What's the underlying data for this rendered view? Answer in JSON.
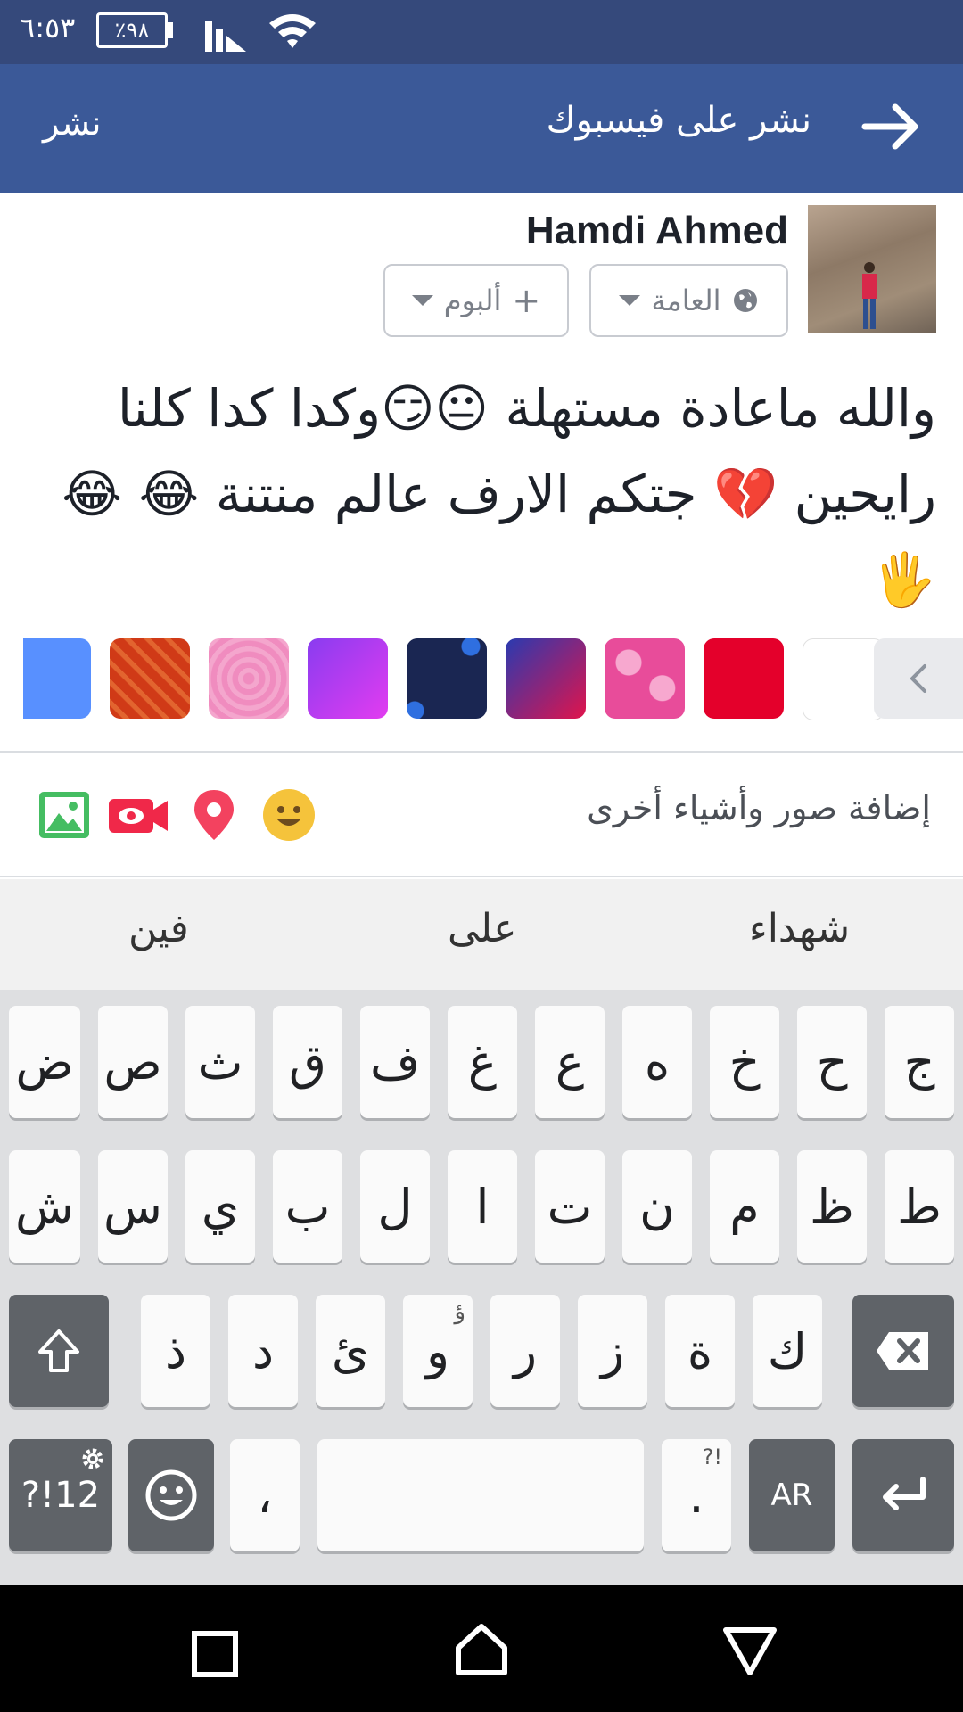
{
  "status_bar": {
    "time": "٦:٥٣",
    "battery": "٪٩٨"
  },
  "app_bar": {
    "post_label": "نشر",
    "title": "نشر على فيسبوك"
  },
  "composer": {
    "user_name": "Hamdi Ahmed",
    "privacy_label": "العامة",
    "album_label": "ألبوم",
    "post_text": "والله ماعادة مستهلة 😐😏وكدا كدا كلنا رايحين 💔 جتكم الارف عالم منتنة 😂 😂🖐"
  },
  "backgrounds": {
    "colors": [
      "#ffffff",
      "#e4002b",
      "#e84c9a",
      "#a6167a",
      "#1a2652",
      "#c13bf0",
      "#f08cbf",
      "#d03a17",
      "#5890ff"
    ]
  },
  "add_bar": {
    "label": "إضافة صور وأشياء أخرى"
  },
  "suggestions": [
    "شهداء",
    "على",
    "فين"
  ],
  "keyboard": {
    "row1": [
      "ج",
      "ح",
      "خ",
      "ه",
      "ع",
      "غ",
      "ف",
      "ق",
      "ث",
      "ص",
      "ض"
    ],
    "row2": [
      "ط",
      "ظ",
      "م",
      "ن",
      "ت",
      "ا",
      "ل",
      "ب",
      "ي",
      "س",
      "ش"
    ],
    "row3": [
      "ك",
      "ة",
      "ز",
      "ر",
      "و",
      "ئ",
      "د",
      "ذ"
    ],
    "row3_alt": "ؤ",
    "symbols_key": "?!12",
    "comma_key": "،",
    "period_key": ".",
    "period_alt": "?!",
    "lang_key": "AR"
  }
}
